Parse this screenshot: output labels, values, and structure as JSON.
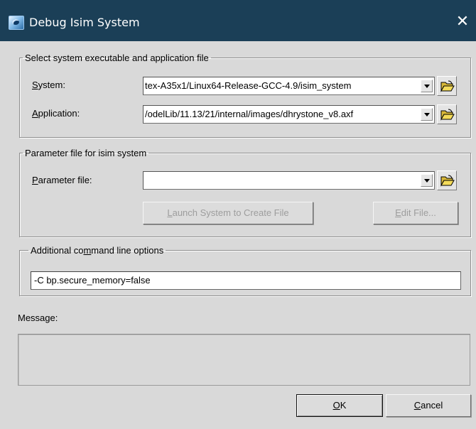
{
  "window": {
    "title": "Debug Isim System",
    "close_symbol": "✕"
  },
  "system_group": {
    "legend": "Select system executable and application file",
    "system_label_ul": "S",
    "system_label_rest": "ystem:",
    "system_value": "tex-A35x1/Linux64-Release-GCC-4.9/isim_system",
    "application_label_ul": "A",
    "application_label_rest": "pplication:",
    "application_value": "/odelLib/11.13/21/internal/images/dhrystone_v8.axf"
  },
  "parameter_group": {
    "legend": "Parameter file for isim system",
    "param_label_ul": "P",
    "param_label_rest": "arameter file:",
    "param_value": "",
    "launch_button_ul": "L",
    "launch_button_rest": "aunch System to Create File",
    "edit_button_ul": "E",
    "edit_button_rest": "dit File..."
  },
  "options_group": {
    "legend_pre": "Additional co",
    "legend_ul": "m",
    "legend_post": "mand line options",
    "value": "-C bp.secure_memory=false"
  },
  "message": {
    "label": "Message:",
    "text": ""
  },
  "buttons": {
    "ok_ul": "O",
    "ok_rest": "K",
    "cancel_ul": "C",
    "cancel_rest": "ancel"
  }
}
